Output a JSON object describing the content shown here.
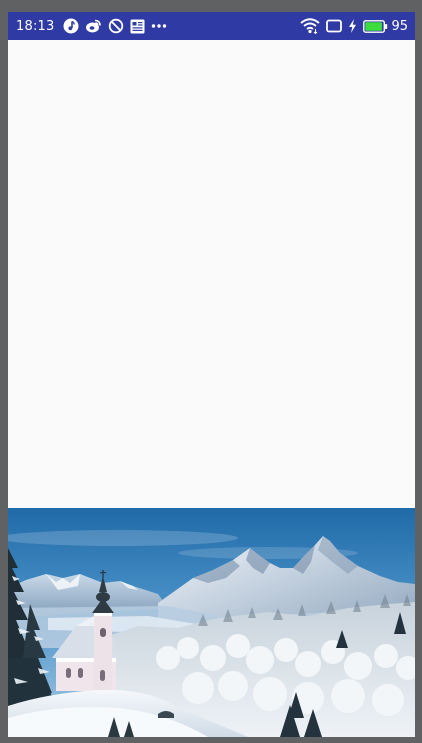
{
  "status_bar": {
    "time": "18:13",
    "battery_level": "95",
    "left_icons": [
      "music-note-icon",
      "weibo-icon",
      "no-disturb-icon",
      "news-icon",
      "more-dots-icon"
    ],
    "right_icons": [
      "wifi-icon",
      "screen-cast-icon",
      "charging-icon",
      "battery-icon"
    ],
    "background_color": "#2f3aa5",
    "battery_fill_color": "#3ddc3d"
  },
  "image": {
    "name": "winter-mountain-church"
  }
}
